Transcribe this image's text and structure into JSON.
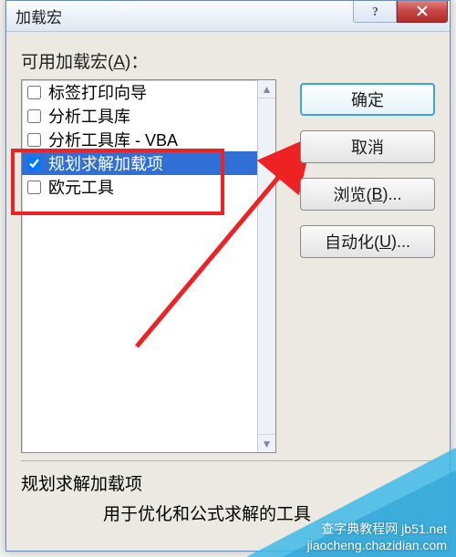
{
  "title": "加载宏",
  "section_label_prefix": "可用加载宏",
  "section_label_key": "A",
  "section_label_suffix": "：",
  "items": [
    {
      "label": "标签打印向导",
      "checked": false,
      "selected": false
    },
    {
      "label": "分析工具库",
      "checked": false,
      "selected": false
    },
    {
      "label": "分析工具库 - VBA",
      "checked": false,
      "selected": false
    },
    {
      "label": "规划求解加载项",
      "checked": true,
      "selected": true
    },
    {
      "label": "欧元工具",
      "checked": false,
      "selected": false
    }
  ],
  "buttons": {
    "ok": "确定",
    "cancel": "取消",
    "browse_prefix": "浏览(",
    "browse_key": "B",
    "browse_suffix": ")...",
    "auto_prefix": "自动化(",
    "auto_key": "U",
    "auto_suffix": ")..."
  },
  "description": {
    "title": "规划求解加载项",
    "text": "用于优化和公式求解的工具"
  },
  "watermark": {
    "line1": "查字典教程网 jb51.net",
    "line2": "jiaocheng.chazidian.com"
  }
}
